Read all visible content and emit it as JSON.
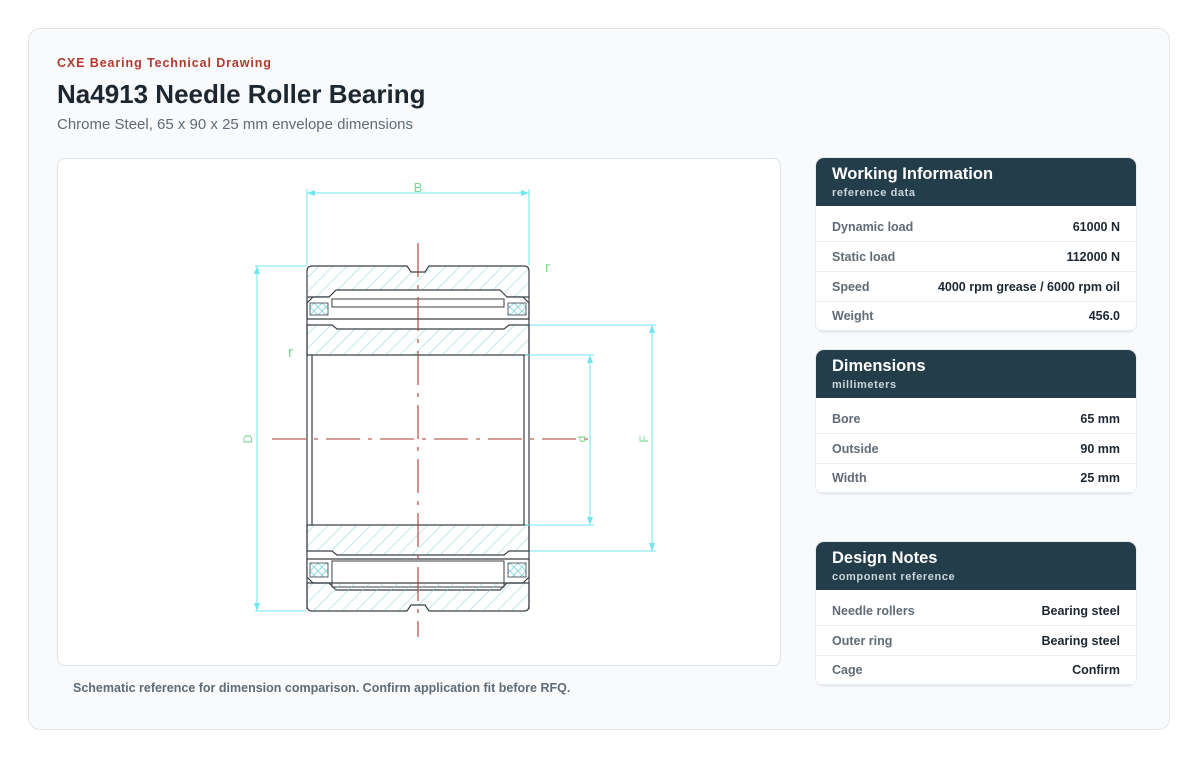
{
  "header": {
    "eyebrow": "CXE Bearing Technical Drawing",
    "title": "Na4913 Needle Roller Bearing",
    "subtitle": "Chrome Steel, 65 x 90 x 25 mm envelope dimensions"
  },
  "drawing": {
    "labels": {
      "B": "B",
      "r_top": "r",
      "r_left": "r",
      "D": "D",
      "d": "d",
      "F": "F"
    },
    "colors": {
      "dimension": "#6fe6ee",
      "label": "#7bd88f",
      "centerline": "#b03a2e",
      "outline": "#3a4046",
      "hatch": "#7fd3da"
    }
  },
  "caption": "Schematic reference for dimension comparison. Confirm application fit before RFQ.",
  "panels": {
    "working": {
      "title": "Working Information",
      "subtitle": "reference data",
      "rows": [
        {
          "label": "Dynamic load",
          "value": "61000 N"
        },
        {
          "label": "Static load",
          "value": "112000 N"
        },
        {
          "label": "Speed",
          "value": "4000 rpm grease / 6000 rpm oil"
        },
        {
          "label": "Weight",
          "value": "456.0"
        }
      ]
    },
    "dimensions": {
      "title": "Dimensions",
      "subtitle": "millimeters",
      "rows": [
        {
          "label": "Bore",
          "value": "65 mm"
        },
        {
          "label": "Outside",
          "value": "90 mm"
        },
        {
          "label": "Width",
          "value": "25 mm"
        }
      ]
    },
    "notes": {
      "title": "Design Notes",
      "subtitle": "component reference",
      "rows": [
        {
          "label": "Needle rollers",
          "value": "Bearing steel"
        },
        {
          "label": "Outer ring",
          "value": "Bearing steel"
        },
        {
          "label": "Cage",
          "value": "Confirm"
        }
      ]
    }
  }
}
